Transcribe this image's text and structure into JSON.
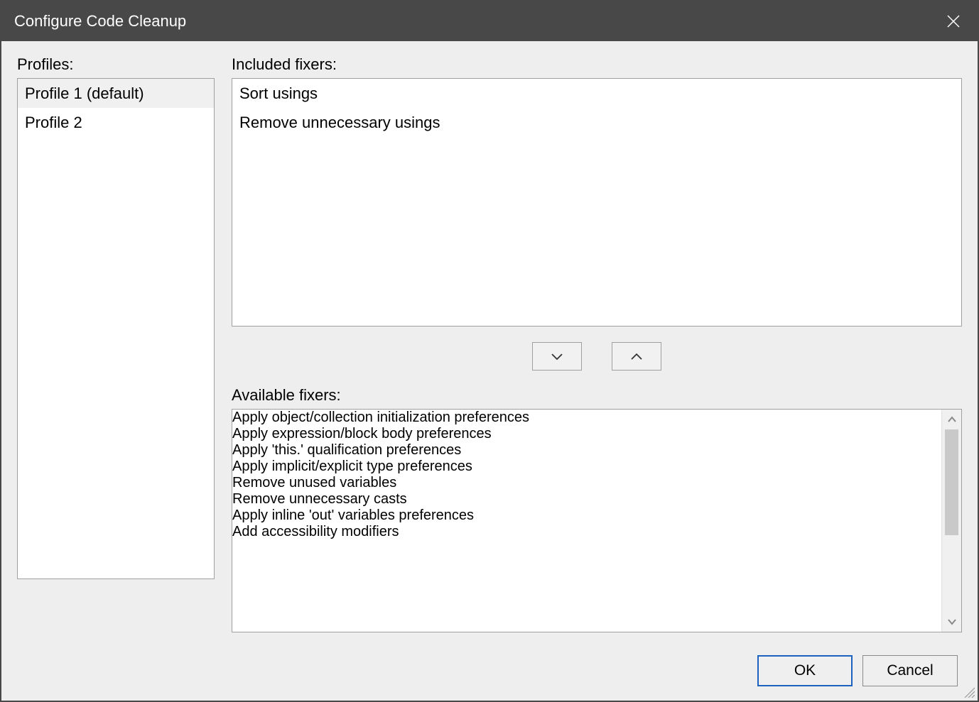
{
  "window": {
    "title": "Configure Code Cleanup"
  },
  "labels": {
    "profiles": "Profiles:",
    "included": "Included fixers:",
    "available": "Available fixers:"
  },
  "profiles": {
    "items": [
      {
        "label": "Profile 1 (default)",
        "selected": true
      },
      {
        "label": "Profile 2",
        "selected": false
      }
    ]
  },
  "included_fixers": {
    "items": [
      "Sort usings",
      "Remove unnecessary usings"
    ]
  },
  "available_fixers": {
    "items": [
      "Apply object/collection initialization preferences",
      "Apply expression/block body preferences",
      "Apply 'this.' qualification preferences",
      "Apply implicit/explicit type preferences",
      "Remove unused variables",
      "Remove unnecessary casts",
      "Apply inline 'out' variables preferences",
      "Add accessibility modifiers"
    ]
  },
  "buttons": {
    "ok": "OK",
    "cancel": "Cancel"
  }
}
